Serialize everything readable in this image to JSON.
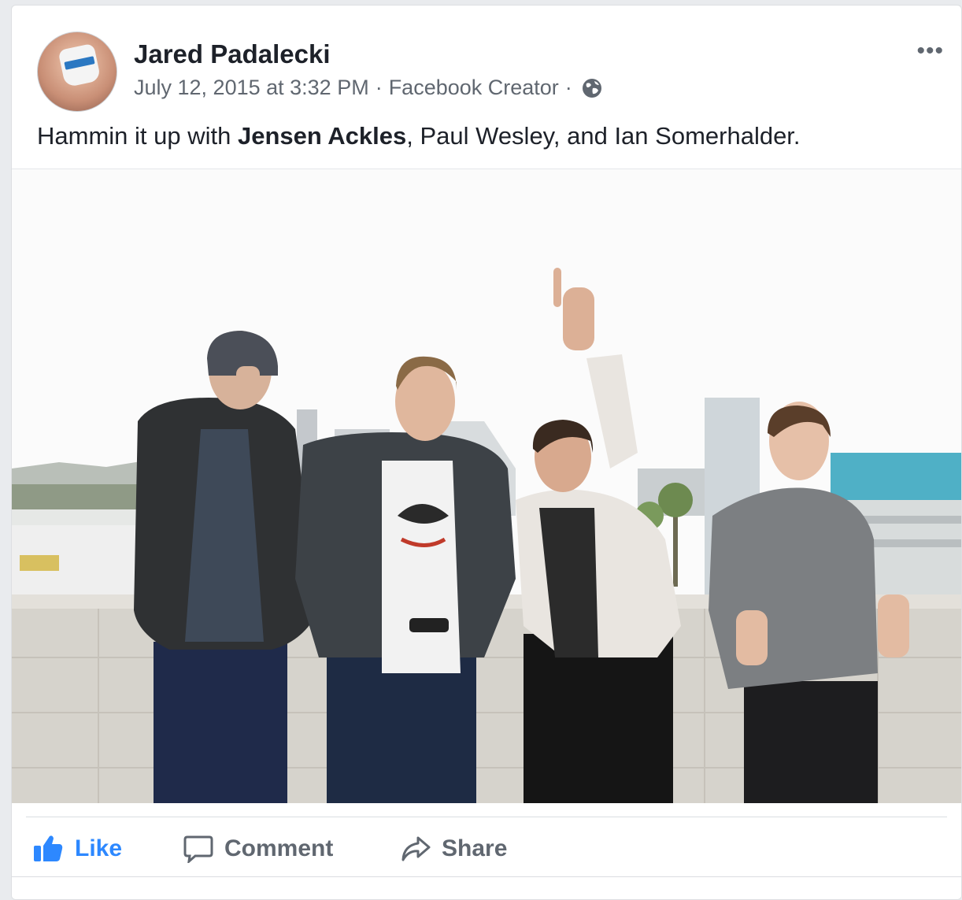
{
  "post": {
    "author": "Jared Padalecki",
    "timestamp": "July 12, 2015 at 3:32 PM",
    "separator": "·",
    "source": "Facebook Creator",
    "privacy_icon": "globe-icon",
    "more_icon": "more-options-icon",
    "more_label": "•••",
    "caption_prefix": "Hammin it up with ",
    "caption_tagged": "Jensen Ackles",
    "caption_suffix": ", Paul Wesley, and Ian Somerhalder."
  },
  "actions": {
    "like_label": "Like",
    "comment_label": "Comment",
    "share_label": "Share"
  },
  "colors": {
    "like_blue": "#2d88ff",
    "text_primary": "#1d2129",
    "text_secondary": "#606770"
  }
}
